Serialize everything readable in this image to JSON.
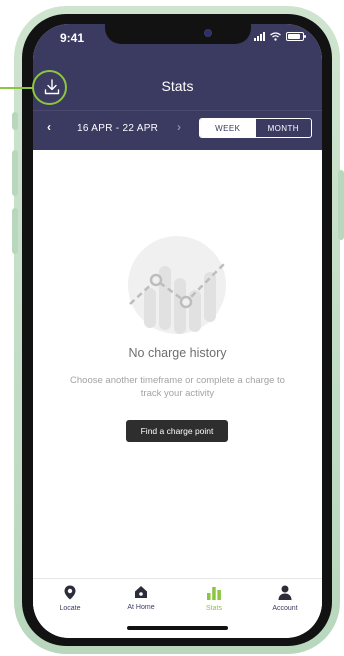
{
  "status_bar": {
    "time": "9:41"
  },
  "header": {
    "title": "Stats",
    "date_range": "16 APR - 22 APR",
    "prev_glyph": "‹",
    "next_glyph": "›",
    "toggle": {
      "week": "WEEK",
      "month": "MONTH",
      "selected": "WEEK"
    }
  },
  "empty_state": {
    "title": "No charge history",
    "description": "Choose another timeframe or complete a charge to track your activity",
    "button_label": "Find a charge point"
  },
  "tab_bar": {
    "active": "Stats",
    "items": [
      {
        "label": "Locate",
        "icon": "location-pin-icon"
      },
      {
        "label": "At Home",
        "icon": "home-icon"
      },
      {
        "label": "Stats",
        "icon": "bar-chart-icon"
      },
      {
        "label": "Account",
        "icon": "person-icon"
      }
    ]
  },
  "colors": {
    "header": "#3b3a61",
    "accent": "#8cc63f",
    "frame": "#b8d7bd"
  }
}
